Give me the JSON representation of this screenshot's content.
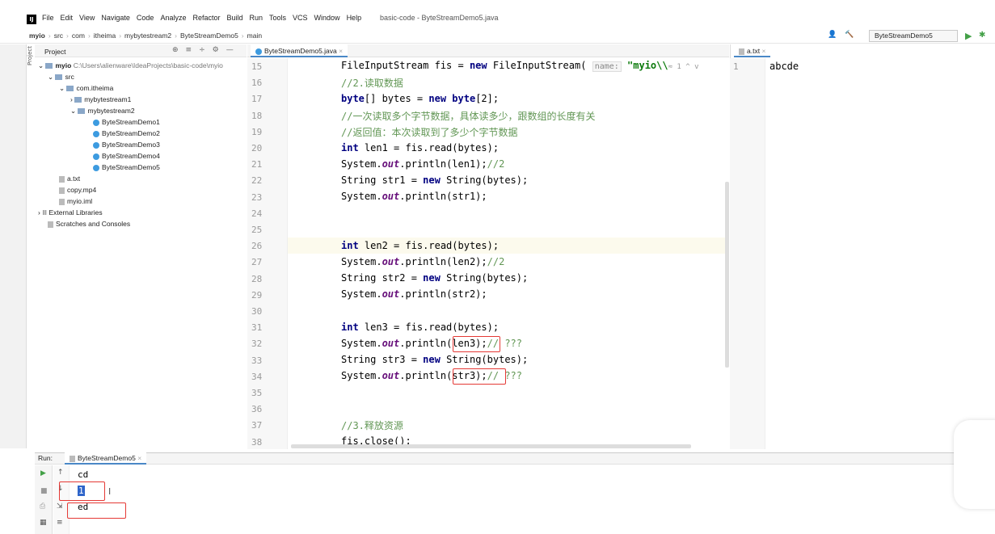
{
  "app": {
    "logo": "IJ",
    "menu": [
      "File",
      "Edit",
      "View",
      "Navigate",
      "Code",
      "Analyze",
      "Refactor",
      "Build",
      "Run",
      "Tools",
      "VCS",
      "Window",
      "Help"
    ],
    "window_title": "basic-code - ByteStreamDemo5.java"
  },
  "breadcrumbs": [
    "myio",
    "src",
    "com",
    "itheima",
    "mybytestream2",
    "ByteStreamDemo5",
    "main"
  ],
  "run_config": "ByteStreamDemo5",
  "sidebar_tab": "Project",
  "project": {
    "title": "Project",
    "root_name": "myio",
    "root_path": "C:\\Users\\alienware\\IdeaProjects\\basic-code\\myio",
    "items": [
      {
        "label": "src"
      },
      {
        "label": "com.itheima"
      },
      {
        "label": "mybytestream1"
      },
      {
        "label": "mybytestream2"
      },
      {
        "label": "ByteStreamDemo1"
      },
      {
        "label": "ByteStreamDemo2"
      },
      {
        "label": "ByteStreamDemo3"
      },
      {
        "label": "ByteStreamDemo4"
      },
      {
        "label": "ByteStreamDemo5"
      },
      {
        "label": "a.txt"
      },
      {
        "label": "copy.mp4"
      },
      {
        "label": "myio.iml"
      },
      {
        "label": "External Libraries"
      },
      {
        "label": "Scratches and Consoles"
      }
    ]
  },
  "editor": {
    "tab": "ByteStreamDemo5.java",
    "line_numbers": [
      "15",
      "16",
      "17",
      "18",
      "19",
      "20",
      "21",
      "22",
      "23",
      "24",
      "25",
      "26",
      "27",
      "28",
      "29",
      "30",
      "31",
      "32",
      "33",
      "34",
      "35",
      "36",
      "37",
      "38"
    ],
    "line15_a": "FileInputStream fis = ",
    "line15_new": "new",
    "line15_b": " FileInputStream( ",
    "line15_hint": "name:",
    "line15_str": " \"myio\\\\",
    "line15_tail": "≈ 1 ^ v",
    "line16": "//2.读取数据",
    "line17_kw1": "byte",
    "line17_a": "[] bytes = ",
    "line17_kw2": "new",
    "line17_kw3": " byte",
    "line17_b": "[2];",
    "line18": "//一次读取多个字节数据，具体读多少，跟数组的长度有关",
    "line19": "//返回值：本次读取到了多少个字节数据",
    "line20_kw": "int",
    "line20_b": " len1 = fis.read(bytes);",
    "line21_a": "System.",
    "line21_out": "out",
    "line21_b": ".println(len1);",
    "line21_cm": "//2",
    "line22_a": "String str1 = ",
    "line22_kw": "new",
    "line22_b": " String(bytes);",
    "line23_a": "System.",
    "line23_out": "out",
    "line23_b": ".println(str1);",
    "line26_kw": "int",
    "line26_b": " len2 = fis.read(bytes);",
    "line27_a": "System.",
    "line27_out": "out",
    "line27_b": ".println(len2);",
    "line27_cm": "//2",
    "line28_a": "String str2 = ",
    "line28_kw": "new",
    "line28_b": " String(bytes);",
    "line29_a": "System.",
    "line29_out": "out",
    "line29_b": ".println(str2);",
    "line31_kw": "int",
    "line31_b": " len3 = fis.read(bytes);",
    "line32_a": "System.",
    "line32_out": "out",
    "line32_b": ".println(len3);",
    "line32_cm": "// ???",
    "line33_a": "String str3 = ",
    "line33_kw": "new",
    "line33_b": " String(bytes);",
    "line34_a": "System.",
    "line34_out": "out",
    "line34_b": ".println(str3);",
    "line34_cm": "// ???",
    "line37": "//3.释放资源",
    "line38": "fis.close();"
  },
  "right_editor": {
    "tab": "a.txt",
    "line_number": "1",
    "content": "abcde"
  },
  "run": {
    "label": "Run:",
    "tab": "ByteStreamDemo5",
    "output": [
      "cd",
      "1",
      "ed"
    ]
  }
}
